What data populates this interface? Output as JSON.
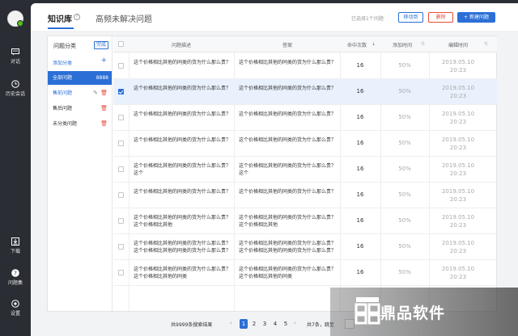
{
  "nav": {
    "items": [
      {
        "label": "对话",
        "icon": "chat-icon"
      },
      {
        "label": "历史会话",
        "icon": "clock-icon"
      },
      {
        "label": "下载",
        "icon": "download-icon"
      },
      {
        "label": "问题集",
        "icon": "question-icon"
      },
      {
        "label": "设置",
        "icon": "settings-icon"
      }
    ]
  },
  "tabs": [
    {
      "label": "知识库",
      "active": true
    },
    {
      "label": "高频未解决问题",
      "active": false
    }
  ],
  "toolbar": {
    "selected_text": "已选择1个问题",
    "move_label": "移动到",
    "delete_label": "删除",
    "new_label": "+ 新建问题"
  },
  "categories": {
    "header": "问题分类",
    "done_label": "完成",
    "add_label": "添加分类",
    "items": [
      {
        "label": "全部问题",
        "count": "8888",
        "active": true
      },
      {
        "label": "售前问题",
        "count": "",
        "active": false
      },
      {
        "label": "售后问题",
        "count": "",
        "active": false
      },
      {
        "label": "未分类问题",
        "count": "",
        "active": false
      }
    ]
  },
  "table": {
    "columns": [
      "问题描述",
      "答案",
      "命中次数",
      "添加时间",
      "编辑时间"
    ],
    "rows": [
      {
        "question": "这个价格相比其他的同类的货为什么那么贵？",
        "answer": "这个价格相比其他的同类的货为什么那么贵？",
        "hits": "16",
        "added": "50%",
        "edited": "2019.05.10 20:23",
        "checked": false
      },
      {
        "question": "这个价格相比其他的同类的货为什么那么贵？",
        "answer": "这个价格相比其他的同类的货为什么那么贵？",
        "hits": "16",
        "added": "50%",
        "edited": "2019.05.10 20:23",
        "checked": true
      },
      {
        "question": "这个价格相比其他的同类的货为什么那么贵？",
        "answer": "这个价格相比其他的同类的货为什么那么贵？",
        "hits": "16",
        "added": "50%",
        "edited": "2019.05.10 20:23",
        "checked": false
      },
      {
        "question": "这个价格相比其他的同类的货为什么那么贵？",
        "answer": "这个价格相比其他的同类的货为什么那么贵？",
        "hits": "16",
        "added": "50%",
        "edited": "2019.05.10 20:23",
        "checked": false
      },
      {
        "question": "这个价格相比其他的同类的货为什么那么贵？这个",
        "answer": "这个价格相比其他的同类的货为什么那么贵？这个",
        "hits": "16",
        "added": "50%",
        "edited": "2019.05.10 20:23",
        "checked": false
      },
      {
        "question": "这个价格相比其他的同类的货为什么那么贵？",
        "answer": "这个价格相比其他的同类的货为什么那么贵？",
        "hits": "16",
        "added": "50%",
        "edited": "2019.05.10 20:23",
        "checked": false
      },
      {
        "question": "这个价格相比其他的同类的货为什么那么贵？这个价格相比其他",
        "answer": "这个价格相比其他的同类的货为什么那么贵？这个价格相比其他",
        "hits": "16",
        "added": "50%",
        "edited": "2019.05.10 20:23",
        "checked": false
      },
      {
        "question": "这个价格相比其他的同类的货为什么那么贵？这个价格相比其他的同类的货为什么那么贵？",
        "answer": "这个价格相比其他的同类的货为什么那么贵？这个价格相比其他的同类的货为什么那么贵？",
        "hits": "16",
        "added": "50%",
        "edited": "2019.05.10 20:23",
        "checked": false
      },
      {
        "question": "这个价格相比其他的同类的货为什么那么贵？这个价格相比其他的同类",
        "answer": "这个价格相比其他的同类的货为什么那么贵？这个价格相比其他的同类",
        "hits": "16",
        "added": "50%",
        "edited": "2019.05.10 20:23",
        "checked": false
      }
    ]
  },
  "pagination": {
    "total_text": "共9999条搜索结果",
    "pages": [
      "1",
      "2",
      "3",
      "4",
      "5"
    ],
    "current": "1",
    "info_text": "共7条，跳至"
  },
  "watermark": {
    "text": "鼎品软件"
  },
  "colors": {
    "accent": "#2b6fd6",
    "danger": "#e74c3c",
    "sidebar": "#2a2d33"
  }
}
